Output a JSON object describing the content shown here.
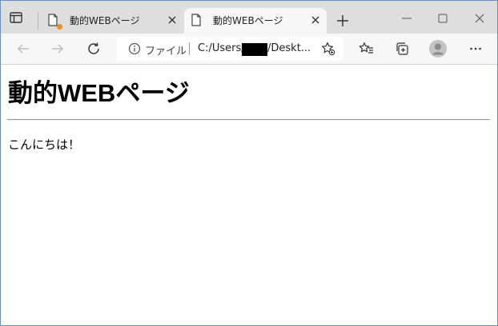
{
  "browser": {
    "tabs": [
      {
        "title": "動的WEBページ",
        "active": false,
        "loading_dot": true
      },
      {
        "title": "動的WEBページ",
        "active": true
      }
    ],
    "address_bar": {
      "scheme_label": "ファイル",
      "url_prefix": "C:/Users/",
      "url_suffix": "/Deskt..."
    },
    "icons": {
      "tab_actions": "tab-actions-icon",
      "new_tab": "plus-icon",
      "back": "arrow-left-icon",
      "forward": "arrow-right-icon",
      "reload": "reload-icon",
      "info": "info-icon",
      "add_favorite": "star-add-icon",
      "favorites": "favorites-icon",
      "collections": "collections-icon",
      "profile": "profile-icon",
      "more": "ellipsis-icon"
    },
    "colors": {
      "tabstrip_bg": "#dedede",
      "active_tab_bg": "#f7f7f7",
      "loading_dot": "#f08c1a"
    }
  },
  "page": {
    "heading": "動的WEBページ",
    "greeting": "こんにちは！"
  }
}
